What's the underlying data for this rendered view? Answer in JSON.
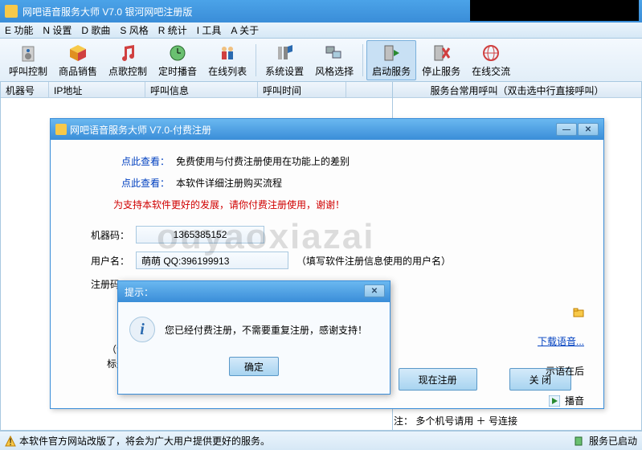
{
  "window": {
    "title": "网吧语音服务大师 V7.0 银河网吧注册版"
  },
  "menu": [
    "E 功能",
    "N 设置",
    "D 歌曲",
    "S 风格",
    "R 统计",
    "I 工具",
    "A 关于"
  ],
  "toolbar": {
    "items": [
      {
        "label": "呼叫控制"
      },
      {
        "label": "商品销售"
      },
      {
        "label": "点歌控制"
      },
      {
        "label": "定时播音"
      },
      {
        "label": "在线列表"
      },
      {
        "label": "系统设置"
      },
      {
        "label": "风格选择"
      },
      {
        "label": "启动服务",
        "selected": true
      },
      {
        "label": "停止服务"
      },
      {
        "label": "在线交流"
      }
    ]
  },
  "grid": {
    "cols": [
      "机器号",
      "IP地址",
      "呼叫信息",
      "呼叫时间"
    ],
    "right_header": "服务台常用呼叫（双击选中行直接呼叫）"
  },
  "reg": {
    "title": "网吧语音服务大师 V7.0-付费注册",
    "link_prefix": "点此查看：",
    "link1": "免费使用与付费注册使用在功能上的差别",
    "link2": "本软件详细注册购买流程",
    "redline": "为支持本软件更好的发展，请你付费注册使用，谢谢！",
    "machine_label": "机器码：",
    "machine_value": "1365385152",
    "user_label": "用户名：",
    "user_value": "萌萌 QQ:396199913",
    "user_hint": "（填写软件注册信息使用的用户名）",
    "code_label": "注册码：",
    "note1": "（注：注册",
    "note2": "标题栏上会显示注册结果，本界面不显示注册码）",
    "btn_reg": "现在注册",
    "btn_close": "关 闭",
    "download": "下载语音...",
    "lang": "示语在后",
    "play": "播音",
    "footnote": "注： 多个机号请用 ＋ 号连接"
  },
  "tip": {
    "title": "提示：",
    "msg": "您已经付费注册，不需要重复注册，感谢支持！",
    "ok": "确定"
  },
  "status": {
    "left": "本软件官方网站改版了，将会为广大用户提供更好的服务。",
    "right": "服务已启动"
  },
  "watermark": "ouyaoxiazai"
}
